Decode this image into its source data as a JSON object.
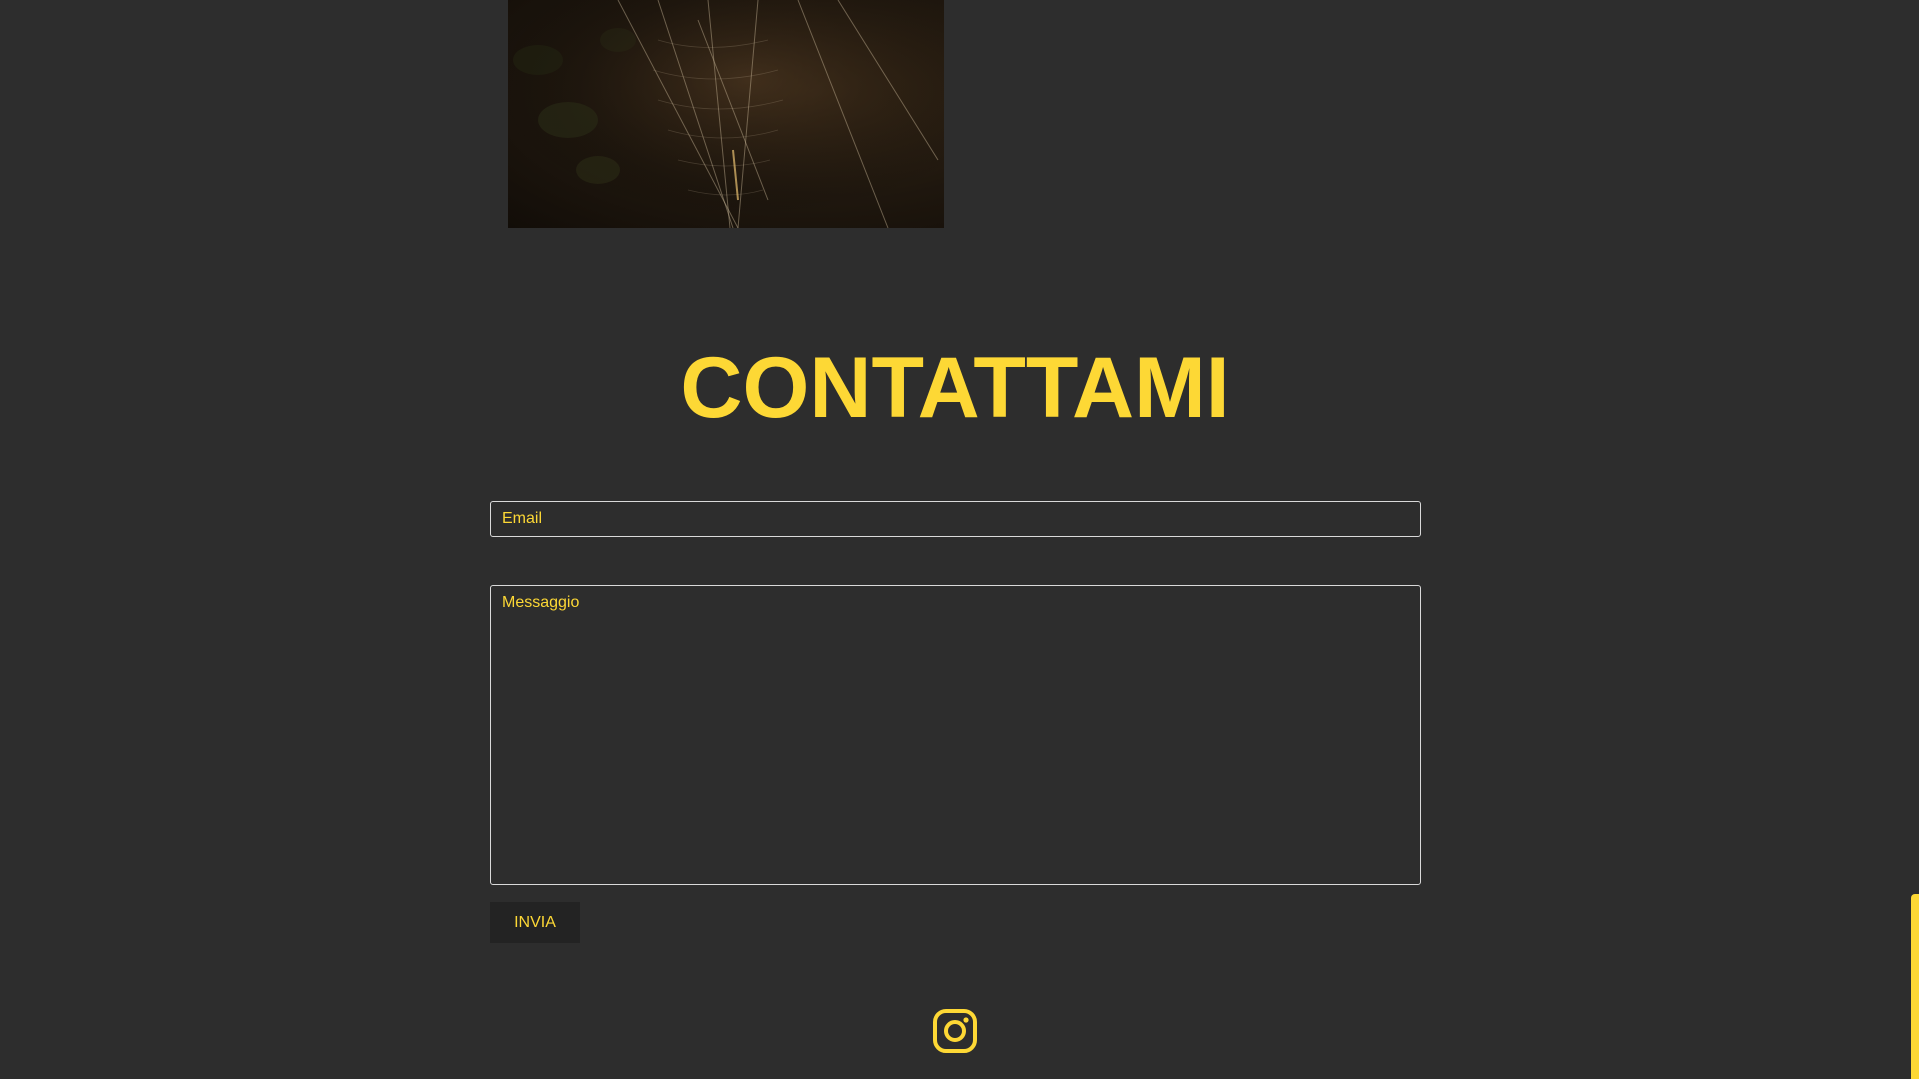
{
  "contact": {
    "title": "CONTATTAMI",
    "email_placeholder": "Email",
    "message_placeholder": "Messaggio",
    "send_label": "INVIA"
  },
  "footer": {
    "social_icon": "instagram-icon"
  },
  "colors": {
    "background": "#2d2d2d",
    "accent": "#fdd835",
    "button_bg": "#232323",
    "field_border": "#d9d9d9"
  }
}
